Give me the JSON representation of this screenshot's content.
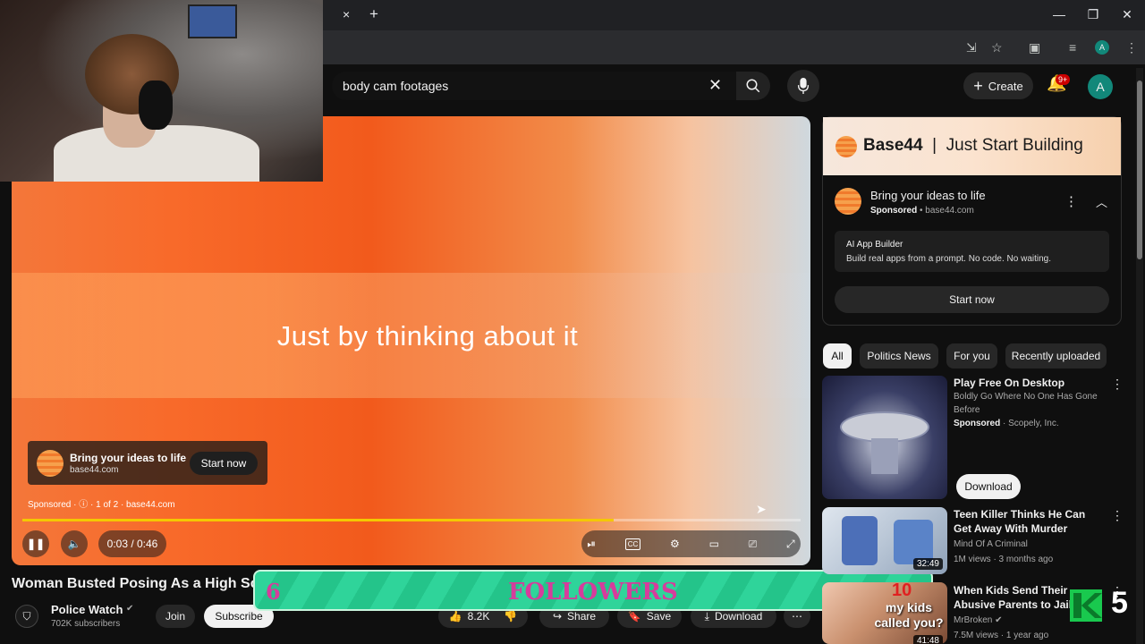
{
  "browser": {
    "tab_close": "×",
    "new_tab": "+",
    "window_controls": [
      "—",
      "❐",
      "✕"
    ]
  },
  "header": {
    "search": {
      "value": "body cam footages",
      "placeholder": "Search"
    },
    "create_label": "Create",
    "notifications_badge": "9+",
    "avatar_letter": "A"
  },
  "player": {
    "headline": "Just by thinking about it",
    "ad_card": {
      "title": "Bring your ideas to life",
      "domain": "base44.com",
      "cta": "Start now"
    },
    "sponsored_line": "Sponsored · ⓘ · 1 of 2 · base44.com",
    "time": "0:03 / 0:46",
    "progress_fraction": 0.76
  },
  "video": {
    "title": "Woman Busted Posing As a High Sc",
    "channel": "Police Watch",
    "subscribers": "702K subscribers",
    "join_label": "Join",
    "subscribe_label": "Subscribe",
    "likes": "8.2K",
    "share_label": "Share",
    "save_label": "Save",
    "download_label": "Download"
  },
  "followers_overlay": {
    "count": "6",
    "label": "FOLLOWERS"
  },
  "sidebar_ad": {
    "banner_brand": "Base44",
    "banner_sep": "|",
    "banner_tagline": "Just Start Building",
    "title": "Bring your ideas to life",
    "sponsored": "Sponsored",
    "domain": "• base44.com",
    "desc_title": "AI App Builder",
    "desc_body": "Build real apps from a prompt. No code. No waiting.",
    "cta": "Start now"
  },
  "chips": [
    "All",
    "Politics News",
    "For you",
    "Recently uploaded"
  ],
  "recommended": [
    {
      "title": "Play Free On Desktop",
      "meta1": "Boldly Go Where No One Has Gone Before",
      "sponsored": "Sponsored",
      "meta2": "· Scopely, Inc.",
      "cta": "Download"
    },
    {
      "title": "Teen Killer Thinks He Can Get Away With Murder",
      "meta1": "Mind Of A Criminal",
      "meta2": "1M views · 3 months ago",
      "duration": "32:49"
    },
    {
      "title": "When Kids Send Their Abusive Parents to Jail",
      "meta1": "MrBroken",
      "meta2": "7.5M views · 1 year ago",
      "duration": "41:48",
      "thumb_text_top": "10",
      "thumb_text": "my kids called you?"
    }
  ],
  "corner_badge": "5",
  "colors": {
    "accent_red": "#cc0000",
    "progress": "#f4c800",
    "follow_green": "#2fd49a",
    "follow_text": "#d63c9c"
  }
}
